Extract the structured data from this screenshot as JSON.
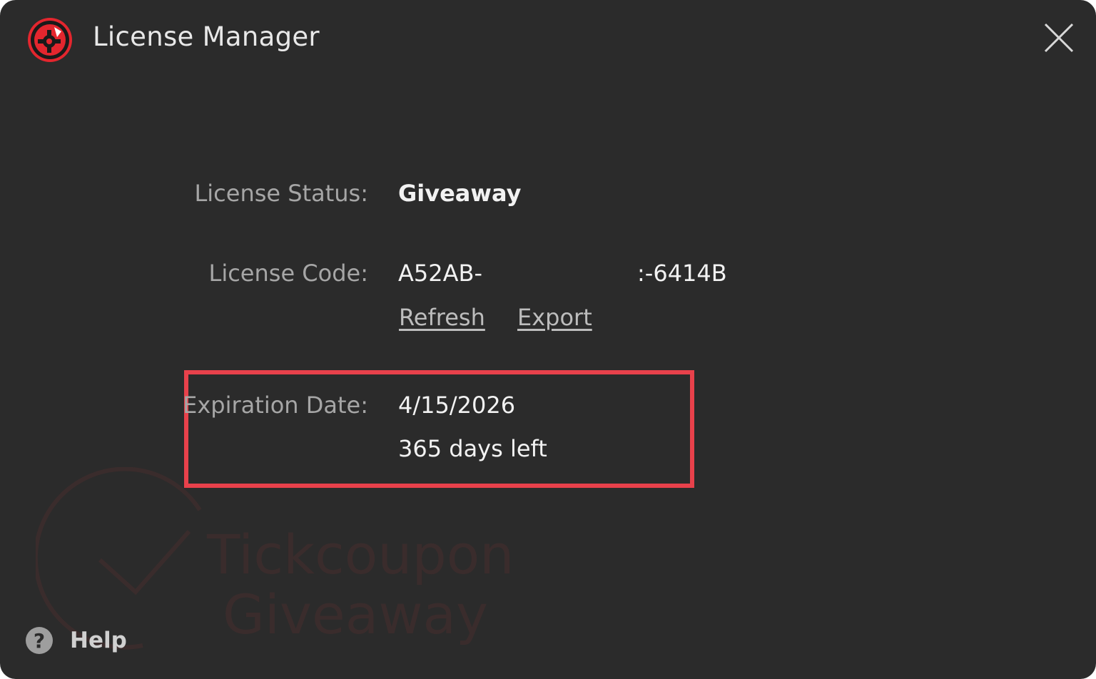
{
  "window": {
    "title": "License Manager"
  },
  "license": {
    "status_label": "License Status:",
    "status_value": "Giveaway",
    "code_label": "License Code:",
    "code_prefix": "A52AB-",
    "code_suffix": ":-6414B",
    "refresh_link": "Refresh",
    "export_link": "Export",
    "expiration_label": "Expiration Date:",
    "expiration_date": "4/15/2026",
    "days_left": "365 days left"
  },
  "watermark": {
    "line1": "Tickcoupon",
    "line2": "Giveaway"
  },
  "footer": {
    "help_label": "Help",
    "help_icon_glyph": "?"
  },
  "colors": {
    "background": "#2b2b2b",
    "highlight": "#e8414b",
    "brand_red": "#e3262e"
  },
  "icons": {
    "app": "app-logo-icon",
    "close": "close-icon",
    "help": "help-icon"
  }
}
